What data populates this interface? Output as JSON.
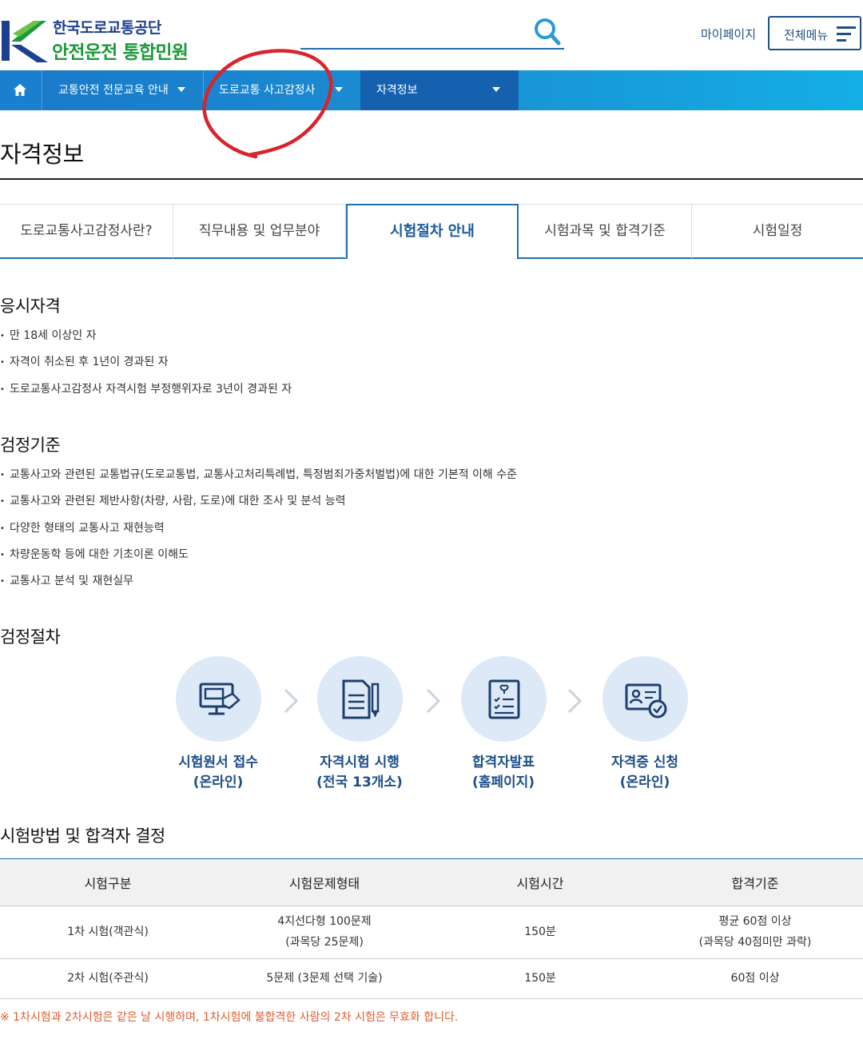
{
  "header": {
    "logo_line1": "한국도로교통공단",
    "logo_line2": "안전운전 통합민원",
    "search_icon": "search-icon",
    "mypage_label": "마이페이지",
    "allmenu_label": "전체메뉴"
  },
  "nav": {
    "home_icon": "home-icon",
    "items": [
      {
        "label": "교통안전 전문교육 안내"
      },
      {
        "label": "도로교통 사고감정사"
      },
      {
        "label": "자격정보"
      }
    ]
  },
  "page": {
    "title": "자격정보"
  },
  "tabs": [
    {
      "label": "도로교통사고감정사란?"
    },
    {
      "label": "직무내용 및 업무분야"
    },
    {
      "label": "시험절차 안내"
    },
    {
      "label": "시험과목 및 합격기준"
    },
    {
      "label": "시험일정"
    }
  ],
  "eligibility": {
    "title": "응시자격",
    "items": [
      "만 18세 이상인 자",
      "자격이 취소된 후 1년이 경과된 자",
      "도로교통사고감정사 자격시험 부정행위자로 3년이 경과된 자"
    ]
  },
  "criteria": {
    "title": "검정기준",
    "items": [
      "교통사고와 관련된 교통법규(도로교통법, 교통사고처리특례법, 특정범죄가중처벌법)에 대한 기본적 이해 수준",
      "교통사고와 관련된 제반사항(차량, 사람, 도로)에 대한 조사 및 분석 능력",
      "다양한 형태의 교통사고 재현능력",
      "차량운동학 등에 대한 기초이론 이해도",
      "교통사고 분석 및 재현실무"
    ]
  },
  "procedure": {
    "title": "검정절차",
    "steps": [
      {
        "line1": "시험원서 접수",
        "line2": "(온라인)",
        "icon": "computer-application-icon"
      },
      {
        "line1": "자격시험 시행",
        "line2": "(전국 13개소)",
        "icon": "exam-paper-icon"
      },
      {
        "line1": "합격자발표",
        "line2": "(홈페이지)",
        "icon": "checklist-icon"
      },
      {
        "line1": "자격증 신청",
        "line2": "(온라인)",
        "icon": "certificate-icon"
      }
    ]
  },
  "method": {
    "title": "시험방법 및 합격자 결정",
    "headers": [
      "시험구분",
      "시험문제형태",
      "시험시간",
      "합격기준"
    ],
    "rows": [
      {
        "type": "1차 시험(객관식)",
        "format_line1": "4지선다형 100문제",
        "format_line2": "(과목당 25문제)",
        "time": "150분",
        "pass_line1": "평균 60점 이상",
        "pass_line2": "(과목당 40점미만 과락)"
      },
      {
        "type": "2차 시험(주관식)",
        "format_line1": "5문제 (3문제 선택 기술)",
        "format_line2": "",
        "time": "150분",
        "pass_line1": "60점 이상",
        "pass_line2": ""
      }
    ],
    "note": "※ 1차시험과 2차시험은 같은 날 시행하며, 1차시험에 불합격한 사람의 2차 시험은 무효화 합니다."
  },
  "colors": {
    "brand_blue": "#1f4f85",
    "brand_green": "#1b9a3a",
    "nav_blue": "#1a8fd3",
    "accent_blue": "#1f6fae",
    "note_orange": "#e45c2f",
    "annotation_red": "#d9232d"
  }
}
